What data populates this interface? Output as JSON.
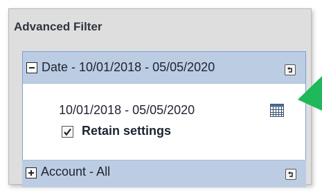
{
  "panel": {
    "title": "Advanced Filter"
  },
  "date_section": {
    "name": "Date",
    "separator": " - ",
    "value": "10/01/2018 - 05/05/2020",
    "range_text": "10/01/2018 - 05/05/2020",
    "retain_label": "Retain settings",
    "retain_checked": true,
    "toggle_icon": "minus-icon",
    "reset_icon": "reset-icon",
    "calendar_icon": "calendar-icon"
  },
  "account_section": {
    "name": "Account",
    "separator": " - ",
    "value": "All",
    "toggle_icon": "plus-icon",
    "reset_icon": "reset-icon"
  },
  "annotation": {
    "arrow_icon": "green-arrow",
    "color": "#1fb85a"
  },
  "colors": {
    "header_bg": "#bccde3",
    "border": "#7aa1d4",
    "panel_bg": "#dedede"
  }
}
